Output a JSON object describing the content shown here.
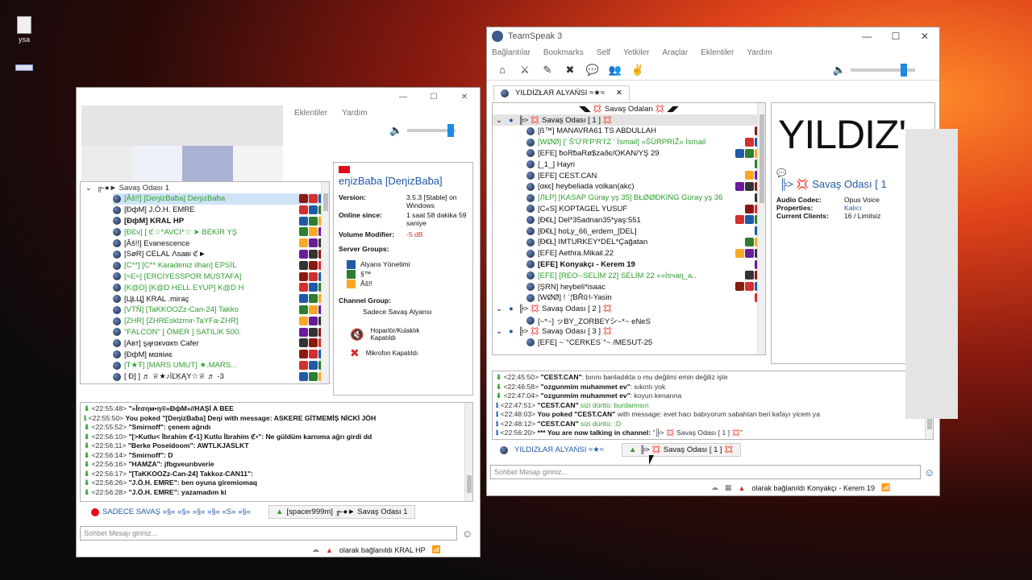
{
  "desktop": {
    "icons": [
      {
        "label": "ysa"
      },
      {
        "label": ""
      }
    ]
  },
  "left_window": {
    "menus": [
      "Eklentiler",
      "Yardım"
    ],
    "tree_title": "╔-●► Savaş Odası 1",
    "users": [
      {
        "name": "[Âš!!] [DeŋizBaƀa] DeŋizBaƀa",
        "selected": true,
        "green": true
      },
      {
        "name": "[ÐфM] J.Ö.H. EMRE"
      },
      {
        "name": "[ÐфM] KRAL HP",
        "bold": true
      },
      {
        "name": "[ÐƐv] [ ℭ☆*AVCI*☆ ➤ BEKİR YŞ",
        "green": true
      },
      {
        "name": "[Âš!!] Evanescence"
      },
      {
        "name": "[SøR] CELAL Λsaвi ℭ►"
      },
      {
        "name": "[C**] [C** Karadeniz ilhan] EPSİL",
        "green": true
      },
      {
        "name": "[≈E≈] [ERCİYESSPOR MUSTAFA]",
        "green": true
      },
      {
        "name": "[K@D] [K@D HELL EYUP] K@D H",
        "green": true
      },
      {
        "name": "[ЦŁЦ] KRAL .miraç"
      },
      {
        "name": "[VTŇ] [TaKKOOZz-Can-24] Takko",
        "green": true
      },
      {
        "name": "[ZHR] [ZHREsklzmir-TaYFa-ZHR]",
        "green": true
      },
      {
        "name": "\"FALCON\" [ ÖMER ] SATILIK 500.",
        "green": true
      },
      {
        "name": "[Aвт] ȿąғαкναкτι Cafer"
      },
      {
        "name": "[ÐфM] мαяiиє"
      },
      {
        "name": "[T★Ŧ] [MARS UMUT] ★.MARS...",
        "green": true
      },
      {
        "name": "[ Ð] ] ♬ ♕★♪İĽĶĄY☆♕ ♬ -3"
      }
    ],
    "info": {
      "title": "eŋizBaƀa [DeŋizBaƀa]",
      "version_label": "Version:",
      "version": "3.5.3 [Stable] on Windows",
      "online_label": "Online since:",
      "online": "1 saat 58 dakika 59 saniye",
      "volume_label": "Volume Modifier:",
      "volume": "-5 dB",
      "server_groups_label": "Server Groups:",
      "groups": [
        "Alyans Yönetimi",
        "§™",
        "Âš!!"
      ],
      "channel_group_label": "Channel Group:",
      "channel_group": "Sadece Savaş Alyansı",
      "speaker": "Hoparlör/Kulaklık Kapatıldı",
      "mic": "Mikrofon Kapatıldı"
    },
    "log": [
      {
        "time": "<22:55:48>",
        "text": "\"»Ĭrσηм•ŋ®«ÐфM»//HAŞİ  A BEE",
        "arrow": true
      },
      {
        "time": "<22:55:50>",
        "text": "You poked \"[DeŋizBaƀa] Deŋi  with message: ASKERE GİTMEMİŞ NİCKİ JÖH",
        "arrow": false
      },
      {
        "time": "<22:55:52>",
        "text": "\"Smirnoff\": çenem ağrıdı",
        "arrow": true
      },
      {
        "time": "<22:56:10>",
        "text": "\"[>Kutlu< İbrahim ℭ•1] Kutlu İbrahim ℭ•\": Ne güldüm karnıma ağrı girdi  dd",
        "arrow": true
      },
      {
        "time": "<22:56:11>",
        "text": "\"Berke Poseidoom\": AWTLKJASLKT",
        "arrow": true
      },
      {
        "time": "<22:56:14>",
        "text": "\"Smirnoff\": D",
        "arrow": true
      },
      {
        "time": "<22:56:16>",
        "text": "\"HAMZA\": jfbgveurıbverie",
        "arrow": true
      },
      {
        "time": "<22:56:17>",
        "text": "\"[TaKKOOZz-Can-24] Takkoz-CAN11\": ",
        "arrow": true
      },
      {
        "time": "<22:56:26>",
        "text": "\"J.Ö.H. EMRE\": ben oyuna giremiomaq",
        "arrow": true
      },
      {
        "time": "<22:56:28>",
        "text": "\"J.Ö.H. EMRE\": yazamadım ki",
        "arrow": true
      }
    ],
    "tabs": [
      "SADECE SAVAŞ  »§«  «§»  »§«  »§«  «S»  »§«",
      "[spacer999m] ╔-●► Savaş Odası 1"
    ],
    "input_placeholder": "Sohbet Mesajı giriniz...",
    "status": "olarak bağlanıldı KRAL HP"
  },
  "right_window": {
    "title": "TeamSpeak 3",
    "menus": [
      "Bağlantılar",
      "Bookmarks",
      "Self",
      "Yetkiler",
      "Araçlar",
      "Eklentiler",
      "Yardım"
    ],
    "server_tab": "YILDIZŁAЯ ALYAŃSI ≈★≈",
    "top_channel": "◥◣ 💢 Savaş Odaları 💢 ◢◤",
    "channel1": "╠> 💢 Savaş Odası [ 1 ] 💢",
    "users": [
      {
        "name": "[ß™] MANAVRA61 TS ABDULLAH"
      },
      {
        "name": "[WØØ] [' Š'Ü'R'P'R'İ'Z ' İsmail] »ŠÜRPRİŽ«  İsmail",
        "green": true
      },
      {
        "name": "[EFE] ƀoRƀaRø$zaðє/OKAN/YŞ 29"
      },
      {
        "name": "[_1_] Hayri"
      },
      {
        "name": "[EFE] CEST.CAN"
      },
      {
        "name": "[αкє] heybeliada volkan(akc)"
      },
      {
        "name": "[ЛŁP] [KASAP Güray yş 35] BŁØØÐKİŃG  Güray yş 36",
        "green": true
      },
      {
        "name": "[C«S] KOPTAGEL YUSUF"
      },
      {
        "name": "[Ð€Ł] Del*35adnan35*yaş:551"
      },
      {
        "name": "[Ð€Ł] hoLy_66_erdem_[DEL]"
      },
      {
        "name": "[Ð€Ł] IMTURKEY*DEL*Çağatan"
      },
      {
        "name": "[EFE] Aethra.Mikail.22"
      },
      {
        "name": "[EFE] Konyakçı - Kerem 19",
        "bold": true
      },
      {
        "name": "[EFE] [REO--SELİM 22] SELİM 22 «»İsчaη_a..",
        "green": true
      },
      {
        "name": "[ŞRN] heybeli*isaac"
      },
      {
        "name": "[WØØ] ! ˈ¦ƁŘŭ˦-Yasin"
      }
    ],
    "channel2": "╠> 💢 Savaş Odası [ 2 ] 💢",
    "channel2_user": "[~*~] ッBY_ZORBEYシ~*~ eNeS",
    "channel3": "╠> 💢 Savaş Odası [ 3 ] 💢",
    "channel3_user": "[EFE] ~˙°CERKES˙°~ /MESUT-25",
    "info": {
      "banner": "YILDIZ'",
      "channel_name": "╠> 💢 Savaş Odası [ 1",
      "codec_label": "Audio Codec:",
      "codec": "Opus Voice",
      "props_label": "Properties:",
      "props": "Kalıcı",
      "clients_label": "Current Clients:",
      "clients": "16 / Limitsiz"
    },
    "log": [
      {
        "time": "<22:45:50>",
        "who": "\"CEST.CAN\"",
        "text": ": bırını banladıkta o mu değilmi emin değiliz işte",
        "kind": "msg"
      },
      {
        "time": "<22:46:58>",
        "who": "\"ozgunmim muhammet ev\"",
        "text": ": sıkıntı yok",
        "kind": "msg"
      },
      {
        "time": "<22:47:04>",
        "who": "\"ozgunmim muhammet ev\"",
        "text": ": koyun kenarına",
        "kind": "msg"
      },
      {
        "time": "<22:47:51>",
        "who": "\"CEST.CAN\"",
        "text": " sizi dürttü: burdamısın",
        "kind": "poke"
      },
      {
        "time": "<22:48:03>",
        "who": "You poked \"CEST.CAN\"",
        "text": " with message: evet hacı babıyorum sabahtan beri kafayı yicem ya",
        "kind": "info"
      },
      {
        "time": "<22:48:12>",
        "who": "\"CEST.CAN\"",
        "text": " sizi dürttü: :D",
        "kind": "poke"
      },
      {
        "time": "<22:56:20>",
        "who": "*** You are now talking in channel: ",
        "text": "\"╠> 💢 Savaş Odası [ 1 ] 💢\"",
        "kind": "info"
      }
    ],
    "tabs": [
      "YILDIZŁAЯ ALYAŃSI ≈★≈",
      "╠> 💢 Savaş Odası [ 1 ] 💢"
    ],
    "input_placeholder": "Sohbet Mesajı giriniz...",
    "status": "olarak bağlanıldı Konyakçı - Kerem 19"
  },
  "colors": {
    "accent": "#1e88e5",
    "green_text": "#2e9e2e",
    "selected_row": "#cfe3f7"
  }
}
